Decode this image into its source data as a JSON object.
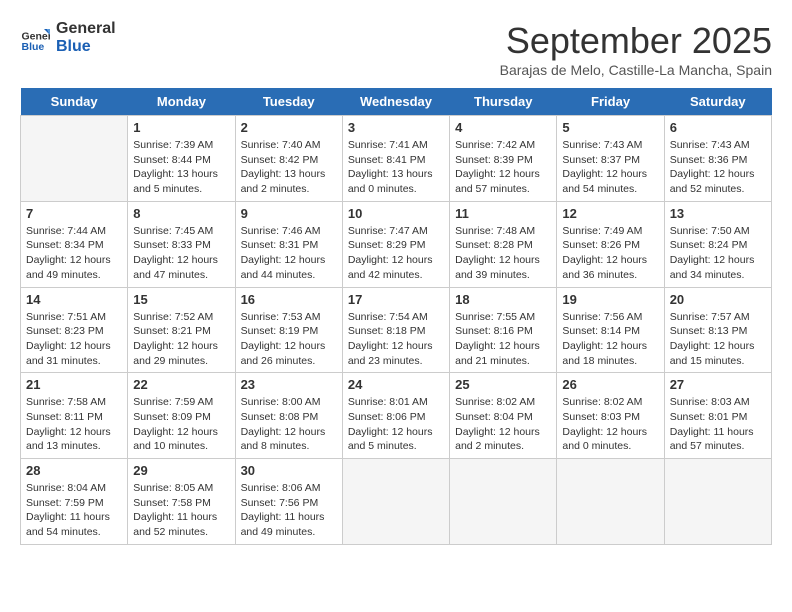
{
  "header": {
    "logo_line1": "General",
    "logo_line2": "Blue",
    "month_title": "September 2025",
    "location": "Barajas de Melo, Castille-La Mancha, Spain"
  },
  "days_of_week": [
    "Sunday",
    "Monday",
    "Tuesday",
    "Wednesday",
    "Thursday",
    "Friday",
    "Saturday"
  ],
  "weeks": [
    [
      {
        "day": "",
        "info": ""
      },
      {
        "day": "1",
        "info": "Sunrise: 7:39 AM\nSunset: 8:44 PM\nDaylight: 13 hours\nand 5 minutes."
      },
      {
        "day": "2",
        "info": "Sunrise: 7:40 AM\nSunset: 8:42 PM\nDaylight: 13 hours\nand 2 minutes."
      },
      {
        "day": "3",
        "info": "Sunrise: 7:41 AM\nSunset: 8:41 PM\nDaylight: 13 hours\nand 0 minutes."
      },
      {
        "day": "4",
        "info": "Sunrise: 7:42 AM\nSunset: 8:39 PM\nDaylight: 12 hours\nand 57 minutes."
      },
      {
        "day": "5",
        "info": "Sunrise: 7:43 AM\nSunset: 8:37 PM\nDaylight: 12 hours\nand 54 minutes."
      },
      {
        "day": "6",
        "info": "Sunrise: 7:43 AM\nSunset: 8:36 PM\nDaylight: 12 hours\nand 52 minutes."
      }
    ],
    [
      {
        "day": "7",
        "info": "Sunrise: 7:44 AM\nSunset: 8:34 PM\nDaylight: 12 hours\nand 49 minutes."
      },
      {
        "day": "8",
        "info": "Sunrise: 7:45 AM\nSunset: 8:33 PM\nDaylight: 12 hours\nand 47 minutes."
      },
      {
        "day": "9",
        "info": "Sunrise: 7:46 AM\nSunset: 8:31 PM\nDaylight: 12 hours\nand 44 minutes."
      },
      {
        "day": "10",
        "info": "Sunrise: 7:47 AM\nSunset: 8:29 PM\nDaylight: 12 hours\nand 42 minutes."
      },
      {
        "day": "11",
        "info": "Sunrise: 7:48 AM\nSunset: 8:28 PM\nDaylight: 12 hours\nand 39 minutes."
      },
      {
        "day": "12",
        "info": "Sunrise: 7:49 AM\nSunset: 8:26 PM\nDaylight: 12 hours\nand 36 minutes."
      },
      {
        "day": "13",
        "info": "Sunrise: 7:50 AM\nSunset: 8:24 PM\nDaylight: 12 hours\nand 34 minutes."
      }
    ],
    [
      {
        "day": "14",
        "info": "Sunrise: 7:51 AM\nSunset: 8:23 PM\nDaylight: 12 hours\nand 31 minutes."
      },
      {
        "day": "15",
        "info": "Sunrise: 7:52 AM\nSunset: 8:21 PM\nDaylight: 12 hours\nand 29 minutes."
      },
      {
        "day": "16",
        "info": "Sunrise: 7:53 AM\nSunset: 8:19 PM\nDaylight: 12 hours\nand 26 minutes."
      },
      {
        "day": "17",
        "info": "Sunrise: 7:54 AM\nSunset: 8:18 PM\nDaylight: 12 hours\nand 23 minutes."
      },
      {
        "day": "18",
        "info": "Sunrise: 7:55 AM\nSunset: 8:16 PM\nDaylight: 12 hours\nand 21 minutes."
      },
      {
        "day": "19",
        "info": "Sunrise: 7:56 AM\nSunset: 8:14 PM\nDaylight: 12 hours\nand 18 minutes."
      },
      {
        "day": "20",
        "info": "Sunrise: 7:57 AM\nSunset: 8:13 PM\nDaylight: 12 hours\nand 15 minutes."
      }
    ],
    [
      {
        "day": "21",
        "info": "Sunrise: 7:58 AM\nSunset: 8:11 PM\nDaylight: 12 hours\nand 13 minutes."
      },
      {
        "day": "22",
        "info": "Sunrise: 7:59 AM\nSunset: 8:09 PM\nDaylight: 12 hours\nand 10 minutes."
      },
      {
        "day": "23",
        "info": "Sunrise: 8:00 AM\nSunset: 8:08 PM\nDaylight: 12 hours\nand 8 minutes."
      },
      {
        "day": "24",
        "info": "Sunrise: 8:01 AM\nSunset: 8:06 PM\nDaylight: 12 hours\nand 5 minutes."
      },
      {
        "day": "25",
        "info": "Sunrise: 8:02 AM\nSunset: 8:04 PM\nDaylight: 12 hours\nand 2 minutes."
      },
      {
        "day": "26",
        "info": "Sunrise: 8:02 AM\nSunset: 8:03 PM\nDaylight: 12 hours\nand 0 minutes."
      },
      {
        "day": "27",
        "info": "Sunrise: 8:03 AM\nSunset: 8:01 PM\nDaylight: 11 hours\nand 57 minutes."
      }
    ],
    [
      {
        "day": "28",
        "info": "Sunrise: 8:04 AM\nSunset: 7:59 PM\nDaylight: 11 hours\nand 54 minutes."
      },
      {
        "day": "29",
        "info": "Sunrise: 8:05 AM\nSunset: 7:58 PM\nDaylight: 11 hours\nand 52 minutes."
      },
      {
        "day": "30",
        "info": "Sunrise: 8:06 AM\nSunset: 7:56 PM\nDaylight: 11 hours\nand 49 minutes."
      },
      {
        "day": "",
        "info": ""
      },
      {
        "day": "",
        "info": ""
      },
      {
        "day": "",
        "info": ""
      },
      {
        "day": "",
        "info": ""
      }
    ]
  ]
}
